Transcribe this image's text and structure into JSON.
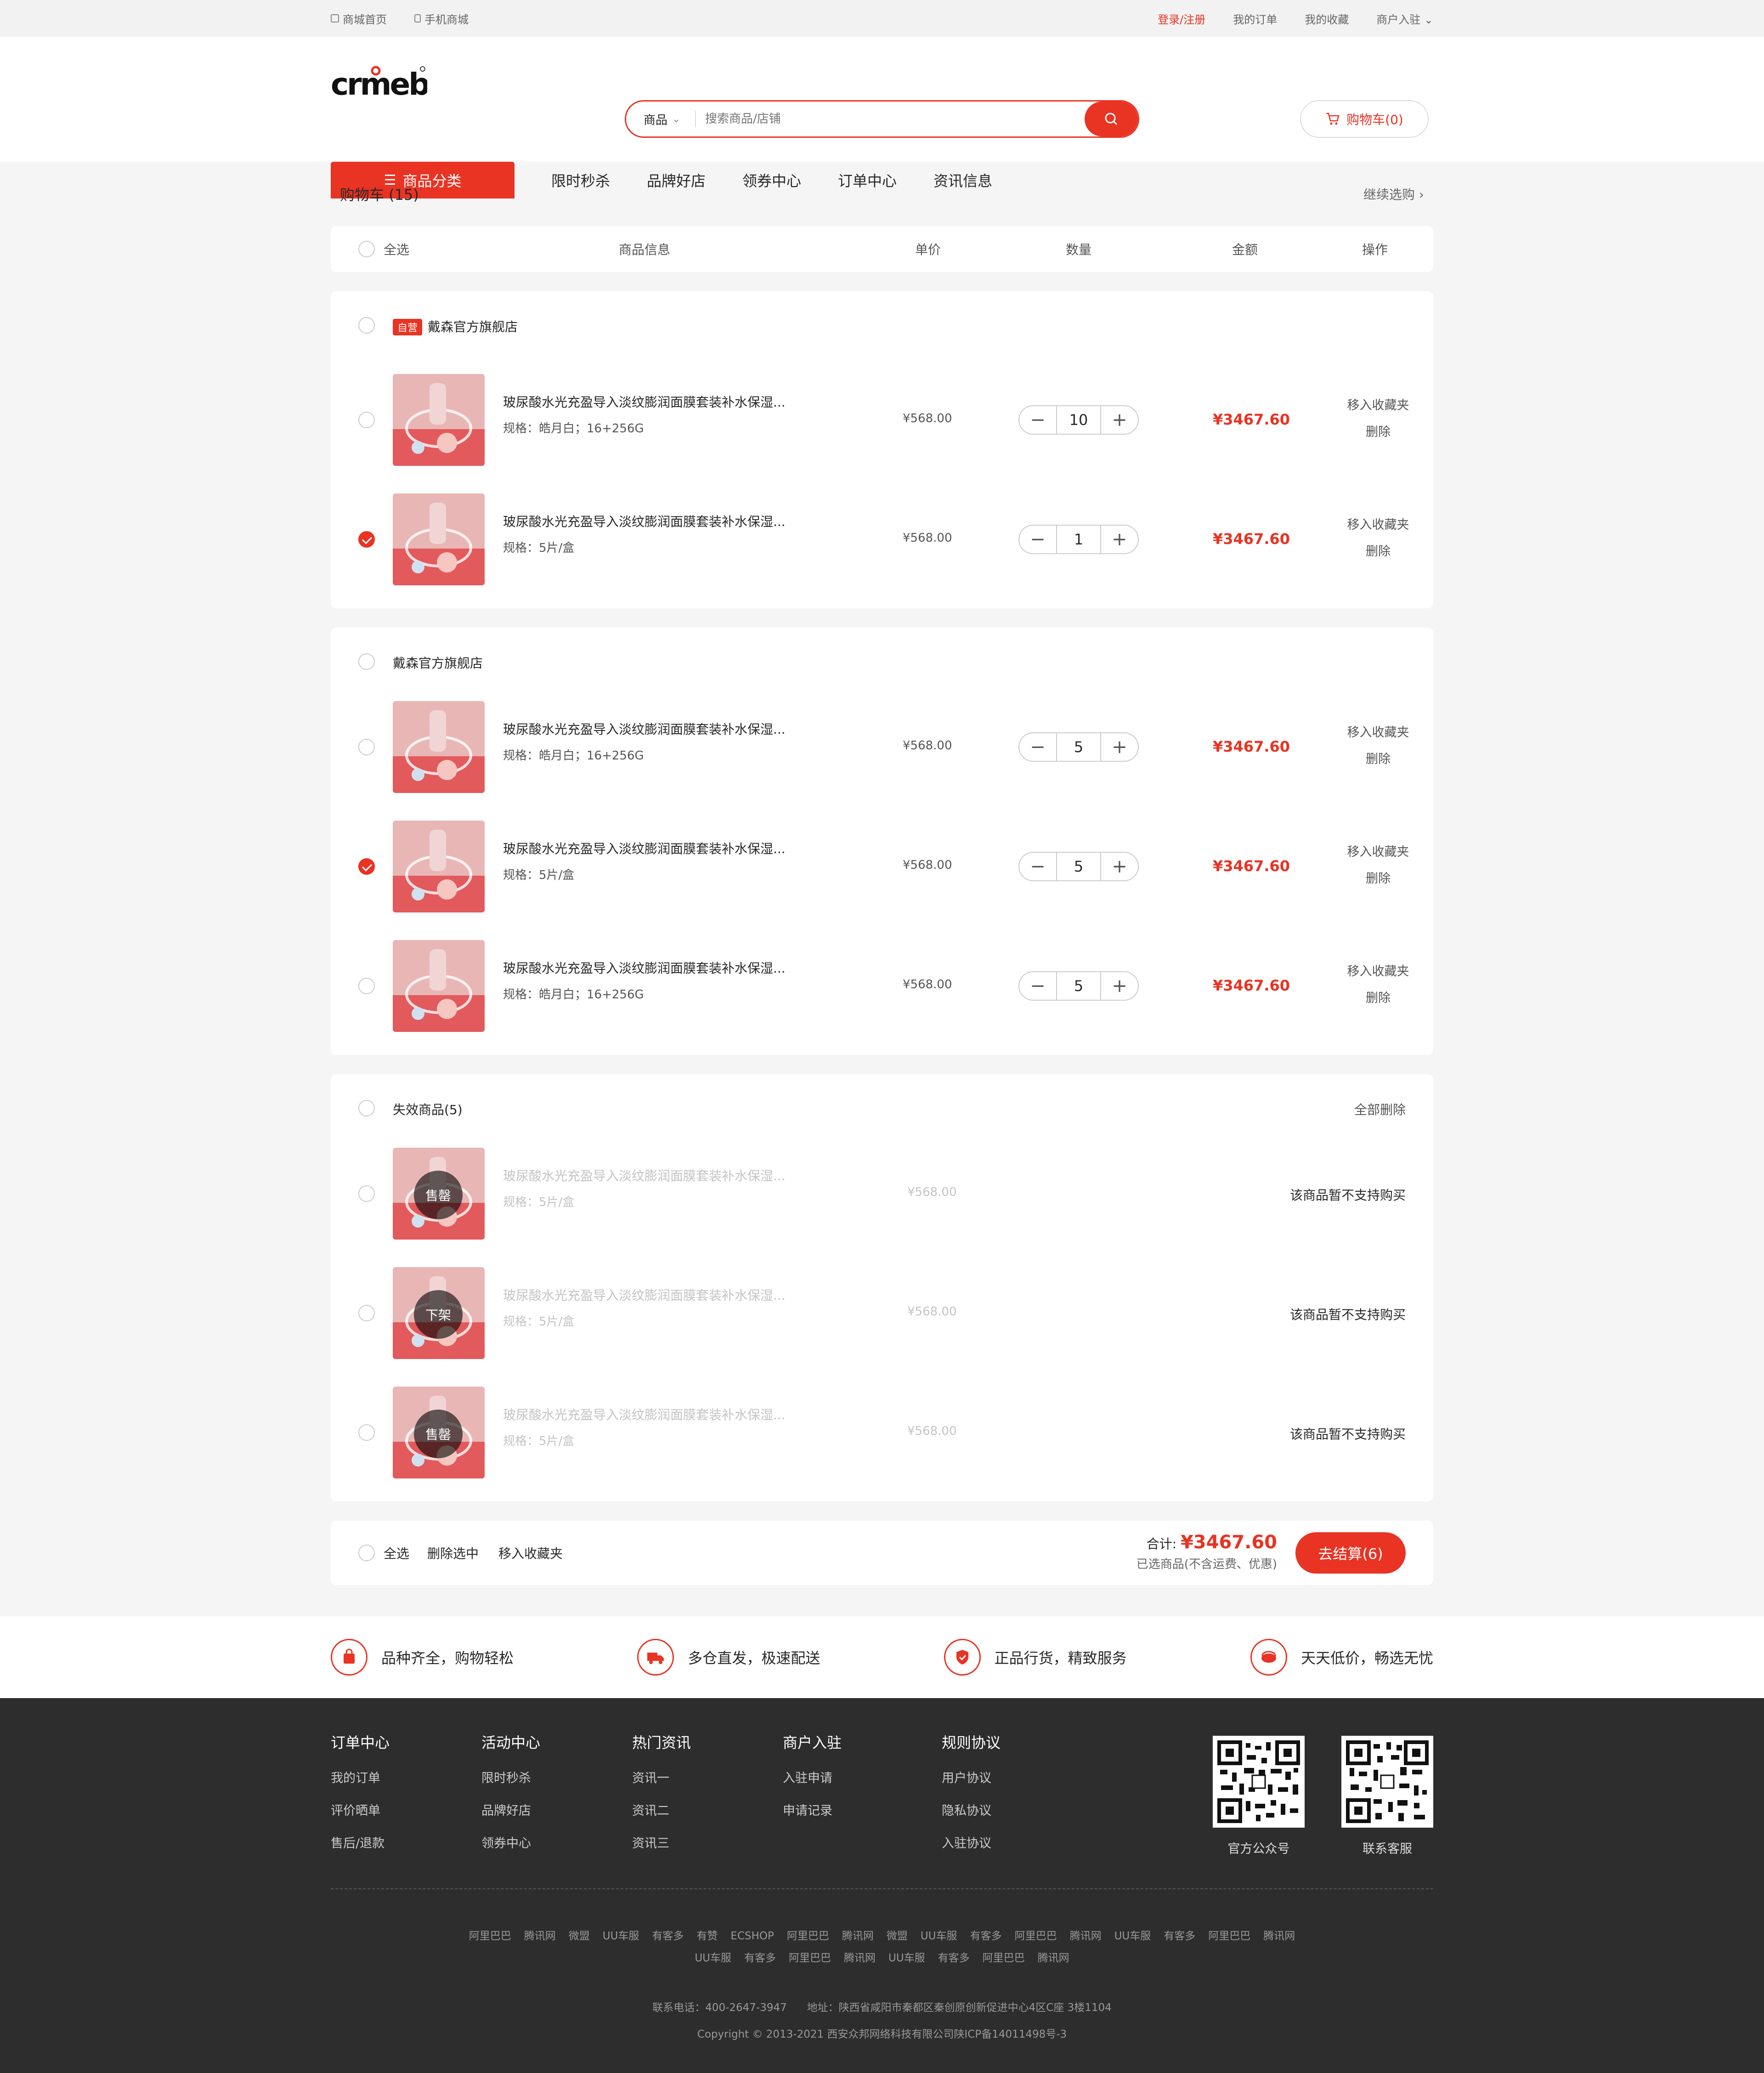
{
  "topbar": {
    "home": "商城首页",
    "mobile": "手机商城",
    "login": "登录/注册",
    "orders": "我的订单",
    "favorites": "我的收藏",
    "merchant": "商户入驻"
  },
  "header": {
    "logo": "crmeb",
    "search_category": "商品",
    "search_placeholder": "搜索商品/店铺",
    "cart_label": "购物车(0)"
  },
  "nav": {
    "category": "商品分类",
    "items": [
      "限时秒杀",
      "品牌好店",
      "领券中心",
      "订单中心",
      "资讯信息"
    ]
  },
  "cart": {
    "title": "购物车 (15)",
    "continue": "继续选购",
    "columns": [
      "全选",
      "商品信息",
      "单价",
      "数量",
      "金额",
      "操作"
    ],
    "move_fav": "移入收藏夹",
    "delete": "删除",
    "spec_prefix": "规格：",
    "stores": [
      {
        "tag": "自营",
        "name": "戴森官方旗舰店",
        "items": [
          {
            "name": "玻尿酸水光充盈导入淡纹膨润面膜套装补水保湿...",
            "spec": "规格：皓月白；16+256G",
            "price": "¥568.00",
            "qty": "10",
            "amount": "¥3467.60",
            "checked": false
          },
          {
            "name": "玻尿酸水光充盈导入淡纹膨润面膜套装补水保湿...",
            "spec": "规格：5片/盒",
            "price": "¥568.00",
            "qty": "1",
            "amount": "¥3467.60",
            "checked": true
          }
        ]
      },
      {
        "tag": "",
        "name": "戴森官方旗舰店",
        "items": [
          {
            "name": "玻尿酸水光充盈导入淡纹膨润面膜套装补水保湿...",
            "spec": "规格：皓月白；16+256G",
            "price": "¥568.00",
            "qty": "5",
            "amount": "¥3467.60",
            "checked": false
          },
          {
            "name": "玻尿酸水光充盈导入淡纹膨润面膜套装补水保湿...",
            "spec": "规格：5片/盒",
            "price": "¥568.00",
            "qty": "5",
            "amount": "¥3467.60",
            "checked": true
          },
          {
            "name": "玻尿酸水光充盈导入淡纹膨润面膜套装补水保湿...",
            "spec": "规格：皓月白；16+256G",
            "price": "¥568.00",
            "qty": "5",
            "amount": "¥3467.60",
            "checked": false
          }
        ]
      }
    ],
    "invalid": {
      "title": "失效商品(5)",
      "delete_all": "全部删除",
      "unsupported": "该商品暂不支持购买",
      "items": [
        {
          "badge": "售罄",
          "name": "玻尿酸水光充盈导入淡纹膨润面膜套装补水保湿...",
          "spec": "规格：5片/盒",
          "price": "¥568.00"
        },
        {
          "badge": "下架",
          "name": "玻尿酸水光充盈导入淡纹膨润面膜套装补水保湿...",
          "spec": "规格：5片/盒",
          "price": "¥568.00"
        },
        {
          "badge": "售罄",
          "name": "玻尿酸水光充盈导入淡纹膨润面膜套装补水保湿...",
          "spec": "规格：5片/盒",
          "price": "¥568.00"
        }
      ]
    },
    "bottom": {
      "select_all": "全选",
      "delete_selected": "删除选中",
      "move_fav": "移入收藏夹",
      "total_label": "合计:",
      "total_value": "¥3467.60",
      "note": "已选商品(不含运费、优惠)",
      "checkout": "去结算(6)"
    }
  },
  "features": [
    "品种齐全，购物轻松",
    "多仓直发，极速配送",
    "正品行货，精致服务",
    "天天低价，畅选无忧"
  ],
  "footer": {
    "columns": [
      {
        "title": "订单中心",
        "items": [
          "我的订单",
          "评价晒单",
          "售后/退款"
        ]
      },
      {
        "title": "活动中心",
        "items": [
          "限时秒杀",
          "品牌好店",
          "领券中心"
        ]
      },
      {
        "title": "热门资讯",
        "items": [
          "资讯一",
          "资讯二",
          "资讯三"
        ]
      },
      {
        "title": "商户入驻",
        "items": [
          "入驻申请",
          "申请记录"
        ]
      },
      {
        "title": "规则协议",
        "items": [
          "用户协议",
          "隐私协议",
          "入驻协议"
        ]
      }
    ],
    "qr": [
      "官方公众号",
      "联系客服"
    ],
    "links1": [
      "阿里巴巴",
      "腾讯网",
      "微盟",
      "UU车服",
      "有客多",
      "有赞",
      "ECSHOP",
      "阿里巴巴",
      "腾讯网",
      "微盟",
      "UU车服",
      "有客多",
      "阿里巴巴",
      "腾讯网",
      "UU车服",
      "有客多",
      "阿里巴巴",
      "腾讯网"
    ],
    "links2": [
      "UU车服",
      "有客多",
      "阿里巴巴",
      "腾讯网",
      "UU车服",
      "有客多",
      "阿里巴巴",
      "腾讯网"
    ],
    "contact": "联系电话：400-2647-3947      地址：陕西省咸阳市秦都区秦创原创新促进中心4区C座 3楼1104",
    "copyright": "Copyright © 2013-2021 西安众邦网络科技有限公司陕ICP备14011498号-3"
  }
}
